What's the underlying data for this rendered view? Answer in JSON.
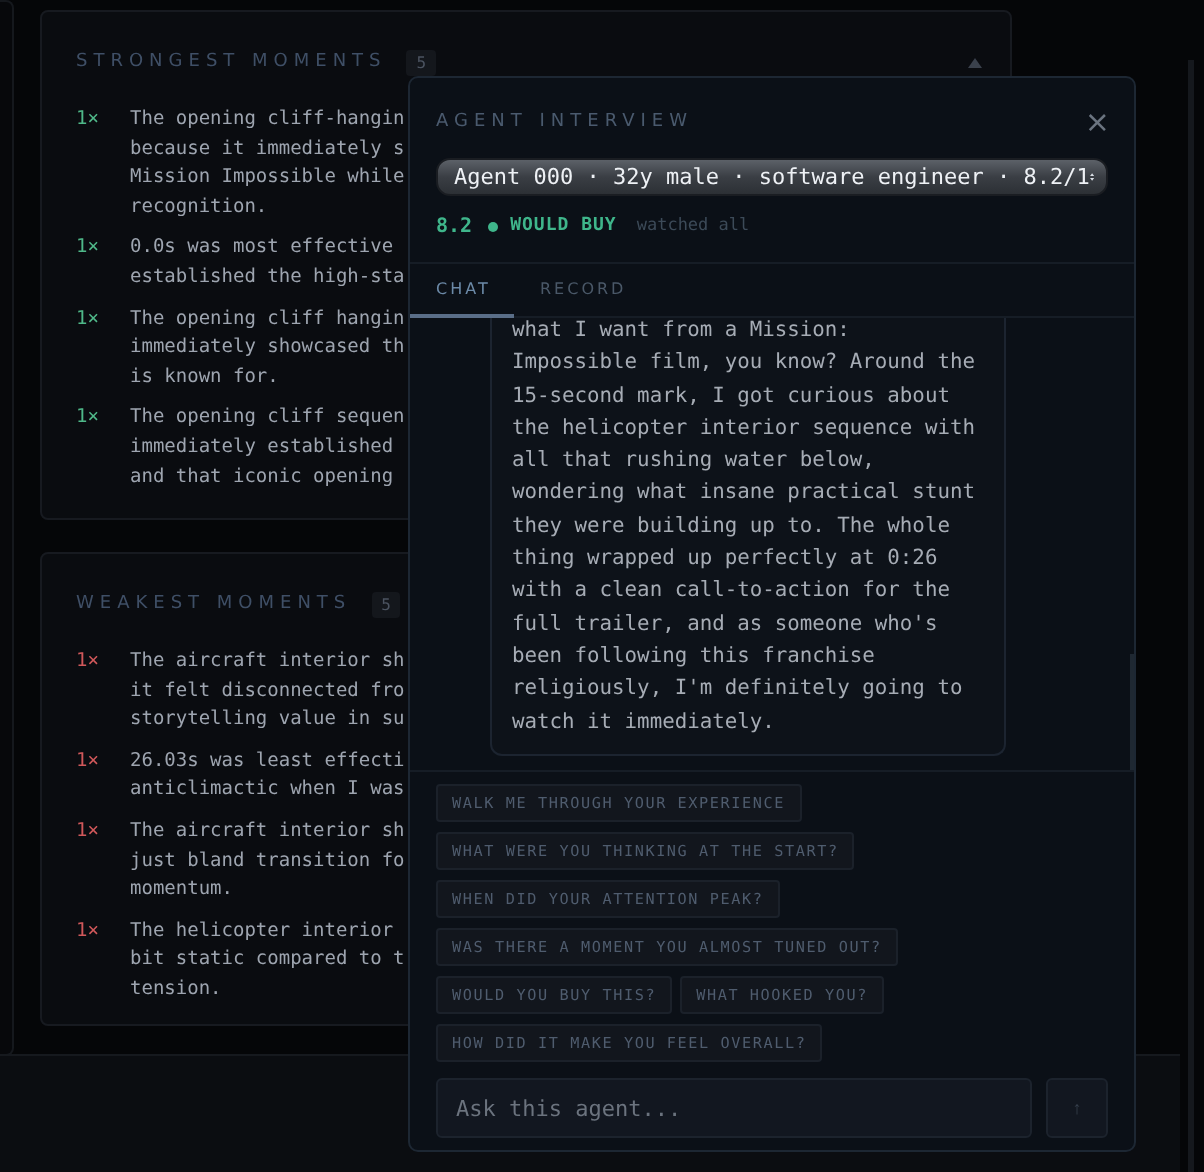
{
  "sections": [
    {
      "title": "STRONGEST MOMENTS",
      "count": "5",
      "color": "#4fb889",
      "items": [
        {
          "count": "1×",
          "text": "The opening cliff-hangin\nbecause it immediately s\nMission Impossible while\nrecognition."
        },
        {
          "count": "1×",
          "text": "0.0s was most effective \nestablished the high-sta"
        },
        {
          "count": "1×",
          "text": "The opening cliff hangin\nimmediately showcased th\nis known for."
        },
        {
          "count": "1×",
          "text": "The opening cliff sequen\nimmediately established \nand that iconic opening "
        }
      ]
    },
    {
      "title": "WEAKEST MOMENTS",
      "count": "5",
      "color": "#d0585a",
      "items": [
        {
          "count": "1×",
          "text": "The aircraft interior sh\nit felt disconnected fro\nstorytelling value in su"
        },
        {
          "count": "1×",
          "text": "26.03s was least effecti\nanticlimactic when I was"
        },
        {
          "count": "1×",
          "text": "The aircraft interior sh\njust bland transition fo\nmomentum."
        },
        {
          "count": "1×",
          "text": "The helicopter interior \nbit static compared to t\ntension."
        }
      ]
    }
  ],
  "interview": {
    "title": "AGENT INTERVIEW",
    "close": "×",
    "agent_select": "Agent 000 · 32y male · software engineer · 8.2/1",
    "score": "8.2",
    "verdict": "WOULD BUY",
    "note": "watched all",
    "tabs": [
      {
        "label": "CHAT",
        "selected": true
      },
      {
        "label": "RECORD",
        "selected": false
      }
    ],
    "message": "what I want from a Mission:\nImpossible film, you know? Around the\n15-second mark, I got curious about\nthe helicopter interior sequence with\nall that rushing water below,\nwondering what insane practical stunt\nthey were building up to. The whole\nthing wrapped up perfectly at 0:26\nwith a clean call-to-action for the\nfull trailer, and as someone who's\nbeen following this franchise\nreligiously, I'm definitely going to\nwatch it immediately.",
    "suggestions": [
      "WALK ME THROUGH YOUR EXPERIENCE",
      "WHAT WERE YOU THINKING AT THE START?",
      "WHEN DID YOUR ATTENTION PEAK?",
      "WAS THERE A MOMENT YOU ALMOST TUNED OUT?",
      "WOULD YOU BUY THIS?",
      "WHAT HOOKED YOU?",
      "HOW DID IT MAKE YOU FEEL OVERALL?"
    ],
    "input": {
      "placeholder": "Ask this agent..."
    },
    "send": "↑"
  }
}
